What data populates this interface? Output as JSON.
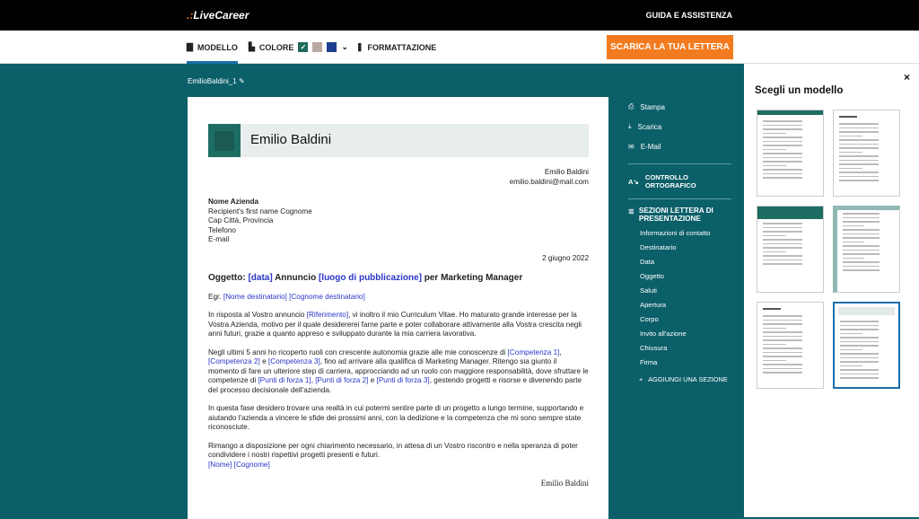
{
  "topbar": {
    "logo": "LiveCareer",
    "help": "GUIDA E ASSISTENZA"
  },
  "toolbar": {
    "modello": "MODELLO",
    "colore": "COLORE",
    "colors": [
      "#1e6b5e",
      "#b9a9a5",
      "#1d3f8f"
    ],
    "formattazione": "FORMATTAZIONE",
    "download": "SCARICA LA TUA LETTERA"
  },
  "file_name": "EmilioBaldini_1",
  "letter": {
    "name": "Emilio Baldini",
    "sender_name": "Emilio Baldini",
    "sender_email": "emilio.baldini@mail.com",
    "recipient": [
      "Nome Azienda",
      "Recipient's first name Cognome",
      "Cap Città, Provincia",
      "Telefono",
      "E-mail"
    ],
    "date": "2 giugno 2022",
    "subject": [
      {
        "t": "Oggetto: "
      },
      {
        "t": "[data]",
        "link": true
      },
      {
        "t": " Annuncio "
      },
      {
        "t": "[luogo di pubblicazione]",
        "link": true
      },
      {
        "t": " per Marketing Manager"
      }
    ],
    "greeting": [
      {
        "t": "Egr. "
      },
      {
        "t": "[Nome destinatario] [Cognome destinatario]",
        "link": true
      }
    ],
    "paragraphs": [
      [
        {
          "t": "In risposta al Vostro annuncio "
        },
        {
          "t": "[Riferimento]",
          "link": true
        },
        {
          "t": ", vi inoltro il mio Curriculum Vitae. Ho maturato grande interesse per la Vostra Azienda, motivo per il quale desidererei farne parte e poter collaborare attivamente alla Vostra crescita negli anni futuri, grazie a quanto appreso e sviluppato durante la mia carriera lavorativa."
        }
      ],
      [
        {
          "t": "Negli ultimi 5 anni ho ricoperto ruoli con crescente autonomia grazie alle mie conoscenze di "
        },
        {
          "t": "[Competenza 1]",
          "link": true
        },
        {
          "t": ", "
        },
        {
          "t": "[Competenza 2]",
          "link": true
        },
        {
          "t": " e "
        },
        {
          "t": "[Competenza 3]",
          "link": true
        },
        {
          "t": ", fino ad arrivare alla qualifica di Marketing Manager. Ritengo sia giunto il momento di fare un ulteriore step di carriera, approcciando ad un ruolo con maggiore responsabilità, dove sfruttare le competenze di "
        },
        {
          "t": "[Punti di forza 1]",
          "link": true
        },
        {
          "t": ", "
        },
        {
          "t": "[Punti di forza 2]",
          "link": true
        },
        {
          "t": " e "
        },
        {
          "t": "[Punti di forza 3]",
          "link": true
        },
        {
          "t": ", gestendo progetti e risorse e divenendo parte del processo decisionale dell'azienda."
        }
      ],
      [
        {
          "t": "In questa fase desidero trovare una realtà in cui potermi sentire parte di un progetto a lungo termine, supportando e aiutando l'azienda a vincere le sfide dei prossimi anni, con la dedizione e la competenza che mi sono sempre state riconosciute."
        }
      ],
      [
        {
          "t": "Rimango a disposizione per ogni chiarimento necessario, in attesa di un Vostro riscontro e nella speranza di poter condividere i nostri rispettivi progetti presenti e futuri."
        },
        {
          "t": "\n"
        },
        {
          "t": "[Nome] [Cognome]",
          "link": true
        }
      ]
    ],
    "signature": "Emilio Baldini"
  },
  "side": {
    "actions": [
      {
        "icon": "printer-icon",
        "glyph": "⎙",
        "label": "Stampa"
      },
      {
        "icon": "download-icon",
        "glyph": "⤓",
        "label": "Scarica"
      },
      {
        "icon": "mail-icon",
        "glyph": "✉",
        "label": "E-Mail"
      }
    ],
    "spell": "CONTROLLO ORTOGRAFICO",
    "sections_title": "SEZIONI LETTERA DI PRESENTAZIONE",
    "sections": [
      "Informazioni di contatto",
      "Destinatario",
      "Data",
      "Oggetto",
      "Saluti",
      "Apertura",
      "Corpo",
      "Invito all'azione",
      "Chiusura",
      "Firma"
    ],
    "add": "AGGIUNGI UNA SEZIONE"
  },
  "templates": {
    "title": "Scegli un modello",
    "close": "×",
    "selected": 5
  }
}
